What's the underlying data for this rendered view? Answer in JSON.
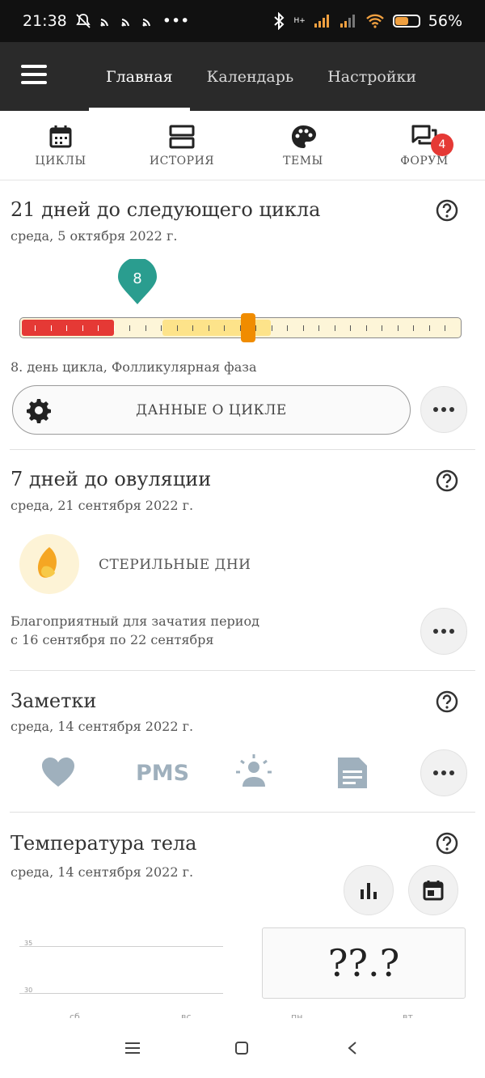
{
  "status": {
    "time": "21:38",
    "battery": "56%",
    "battery_level": 0.56,
    "network_label": "H+"
  },
  "topbar": {
    "tabs": [
      {
        "label": "Главная"
      },
      {
        "label": "Календарь"
      },
      {
        "label": "Настройки"
      }
    ]
  },
  "quicknav": {
    "items": [
      {
        "label": "ЦИКЛЫ",
        "icon": "calendar-icon"
      },
      {
        "label": "ИСТОРИЯ",
        "icon": "history-icon"
      },
      {
        "label": "ТЕМЫ",
        "icon": "palette-icon"
      },
      {
        "label": "ФОРУМ",
        "icon": "forum-icon",
        "badge": "4"
      }
    ]
  },
  "cycle": {
    "title": "21 дней до следующего цикла",
    "date": "среда, 5 октября 2022 г.",
    "day_marker": "8",
    "phase_text": "8. день цикла, Фолликулярная фаза",
    "button_label": "ДАННЫЕ О ЦИКЛЕ",
    "colors": {
      "period": "#e53935",
      "fertile": "#fde38a",
      "marker": "#f08c00",
      "pin": "#2a9d8f"
    }
  },
  "ovulation": {
    "title": "7 дней до овуляции",
    "date": "среда, 21 сентября 2022 г.",
    "status_label": "СТЕРИЛЬНЫЕ ДНИ",
    "period_line1": "Благоприятный для зачатия период",
    "period_line2": "с 16 сентября по 22 сентября"
  },
  "notes": {
    "title": "Заметки",
    "date": "среда, 14 сентября 2022 г.",
    "pms_label": "PMS",
    "icons": [
      "heart-icon",
      "pms-icon",
      "sun-person-icon",
      "document-icon"
    ]
  },
  "temperature": {
    "title": "Температура тела",
    "date": "среда, 14 сентября 2022 г.",
    "value": "??.?",
    "grid_labels": [
      "35",
      "30"
    ],
    "x_labels": [
      "сб",
      "вс",
      "пн",
      "вт"
    ]
  }
}
